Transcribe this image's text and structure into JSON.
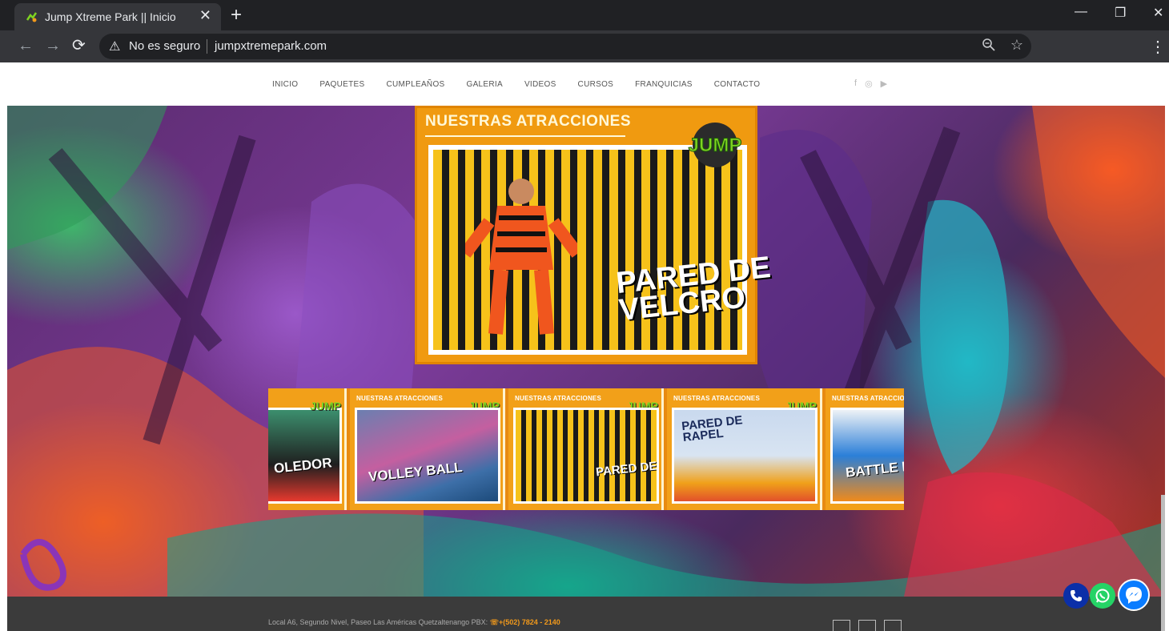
{
  "browser": {
    "tab_title": "Jump Xtreme Park || Inicio",
    "security_label": "No es seguro",
    "url": "jumpxtremepark.com"
  },
  "site": {
    "menu": [
      "INICIO",
      "PAQUETES",
      "CUMPLEAÑOS",
      "GALERIA",
      "VIDEOS",
      "CURSOS",
      "FRANQUICIAS",
      "CONTACTO"
    ],
    "social_icons": [
      "facebook-icon",
      "instagram-icon",
      "youtube-icon"
    ]
  },
  "featured": {
    "header": "NUESTRAS ATRACCIONES",
    "logo": "JUMP",
    "caption_line1": "PARED DE",
    "caption_line2": "VELCRO"
  },
  "carousel": {
    "slides": [
      {
        "header": "",
        "caption": "OLEDOR"
      },
      {
        "header": "NUESTRAS ATRACCIONES",
        "caption": "VOLLEY BALL"
      },
      {
        "header": "NUESTRAS ATRACCIONES",
        "caption": "PARED DE VELCRO"
      },
      {
        "header": "NUESTRAS ATRACCIONES",
        "caption": "PARED DE RAPEL"
      },
      {
        "header": "NUESTRAS ATRACCIONES",
        "caption": "BATTLE BE"
      }
    ],
    "logo": "JUMP"
  },
  "footer": {
    "address": "Local A6, Segundo Nivel, Paseo Las Américas Quetzaltenango PBX:",
    "phone": "+(502) 7824 - 2140"
  },
  "colors": {
    "accent_orange": "#f09a10",
    "footer_bg": "#3b3b3b",
    "whatsapp": "#25d366",
    "messenger": "#0a7cff",
    "phone_fab": "#0b2fa8"
  }
}
